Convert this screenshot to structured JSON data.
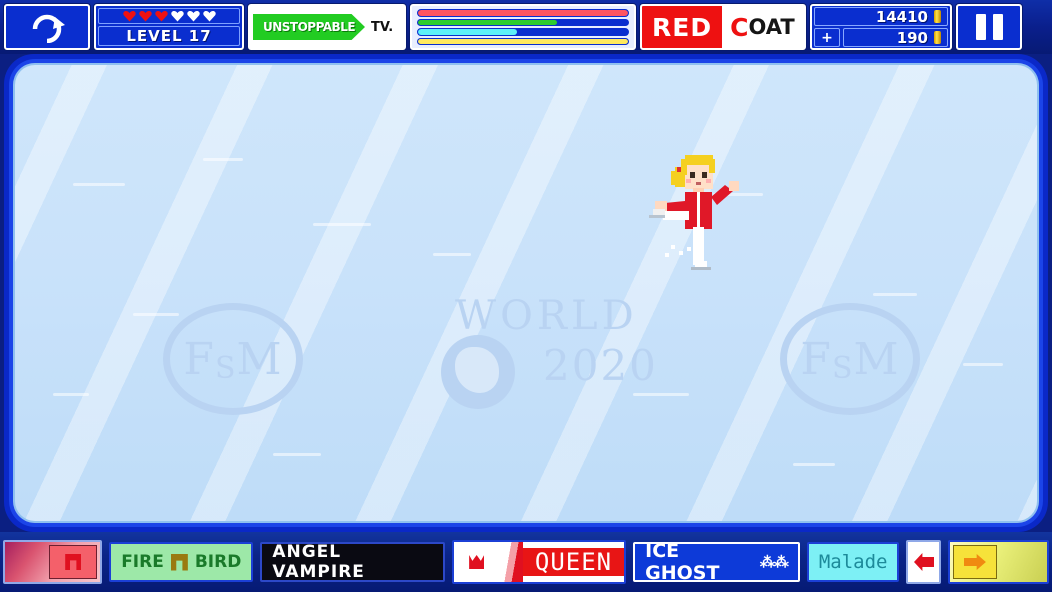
{
  "hud": {
    "refresh_icon": "refresh-icon",
    "level_label": "LEVEL 17",
    "hearts_total": 6,
    "hearts_filled": 3,
    "unstoppable_label": "UNSTOPPABLE",
    "unstoppable_suffix": "TV.",
    "meters": [
      {
        "name": "red-meter",
        "color": "#ff5560",
        "percent": 100
      },
      {
        "name": "green-meter",
        "color": "#2ecc2e",
        "percent": 66
      },
      {
        "name": "cyan-meter",
        "color": "#5ef0f8",
        "percent": 47
      },
      {
        "name": "yellow-meter",
        "color": "#ffe95e",
        "percent": 100
      }
    ],
    "character": {
      "first": "RED",
      "second_initial": "C",
      "second_rest": "OAT"
    },
    "score_total": "14410",
    "score_delta": "190",
    "plus_label": "+",
    "pause_icon": "pause-icon"
  },
  "rink": {
    "watermark_fsm": {
      "f": "F",
      "s": "S",
      "m": "M"
    },
    "watermark_world": "WORLD",
    "watermark_year": "2020",
    "globe_icon": "globe-icon",
    "skater_icon": "figure-skater-character",
    "gem_icon": "red-gem-pickup"
  },
  "bottom_bar": {
    "items": [
      {
        "name": "powerup-gauge",
        "label": ""
      },
      {
        "name": "fire-bird-badge",
        "label_left": "FIRE",
        "label_right": "BIRD"
      },
      {
        "name": "angel-vampire-badge",
        "label": "ANGEL VAMPIRE"
      },
      {
        "name": "queen-badge",
        "label": "QUEEN"
      },
      {
        "name": "ice-ghost-badge",
        "label": "ICE GHOST",
        "glyph": "⁂⁂"
      },
      {
        "name": "malade-badge",
        "label": "Malade"
      },
      {
        "name": "arrow-button",
        "label": ""
      },
      {
        "name": "boost-meter",
        "label": ""
      }
    ]
  },
  "colors": {
    "hud_blue": "#0a2ecf",
    "rink_border": "#0a28c8",
    "ice": "#cfe6fb",
    "accent_red": "#ee1111"
  }
}
